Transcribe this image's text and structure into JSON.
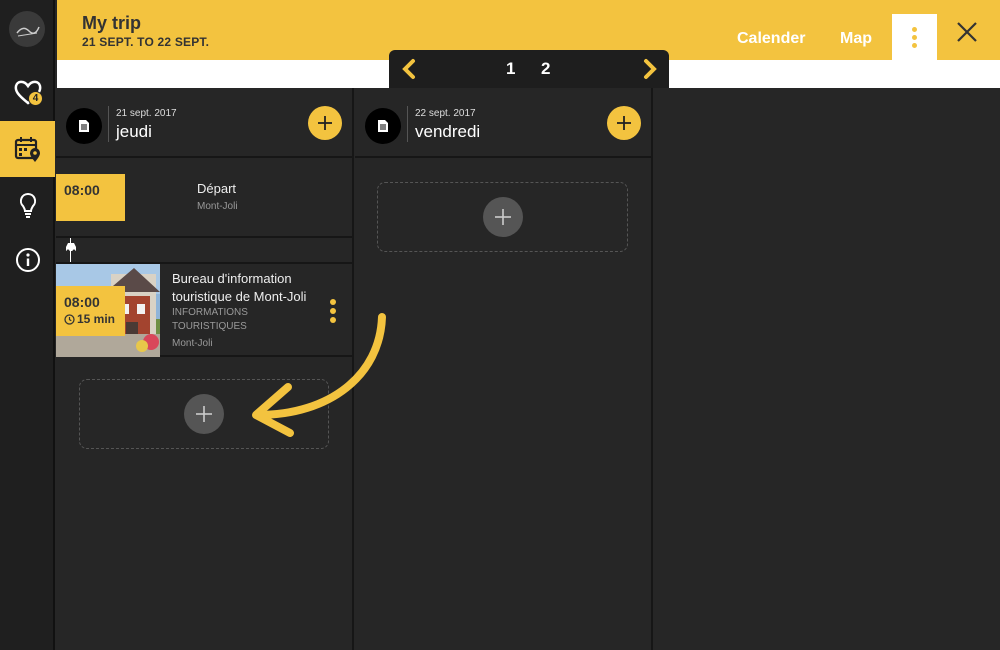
{
  "header": {
    "title": "My trip",
    "dates": "21 SEPT. TO 22 SEPT.",
    "nav": [
      "Calender",
      "Map"
    ]
  },
  "sidebar": {
    "items": [
      {
        "name": "logo",
        "icon": "logo-icon"
      },
      {
        "name": "favorites",
        "icon": "heart-icon",
        "badge": "4"
      },
      {
        "name": "trip-calendar",
        "icon": "calendar-pin-icon",
        "active": true
      },
      {
        "name": "ideas",
        "icon": "lightbulb-icon"
      },
      {
        "name": "info",
        "icon": "info-icon"
      }
    ]
  },
  "pager": {
    "pages": [
      "1",
      "2"
    ]
  },
  "columns": [
    {
      "date": "21 sept. 2017",
      "day": "jeudi",
      "items": [
        {
          "time": "08:00",
          "title": "Départ",
          "location": "Mont-Joli"
        },
        {
          "time": "08:00",
          "duration": "15 min",
          "title": "Bureau d'information touristique de Mont-Joli",
          "category": "INFORMATIONS TOURISTIQUES",
          "location": "Mont-Joli"
        }
      ],
      "transport_icon": "car-icon"
    },
    {
      "date": "22 sept. 2017",
      "day": "vendredi",
      "items": []
    }
  ],
  "colors": {
    "accent": "#f3c33f",
    "background": "#262626",
    "sidebar": "#1f1f1f"
  }
}
